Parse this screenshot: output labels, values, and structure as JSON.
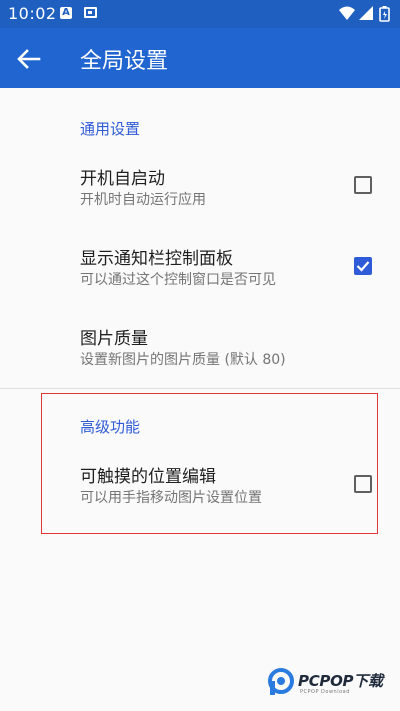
{
  "status_bar": {
    "time": "10:02",
    "a_icon": "A"
  },
  "app_bar": {
    "title": "全局设置",
    "back_icon": "arrow-left-icon"
  },
  "sections": [
    {
      "title": "通用设置",
      "items": [
        {
          "title": "开机自启动",
          "summary": "开机时自动运行应用",
          "checkbox": false
        },
        {
          "title": "显示通知栏控制面板",
          "summary": "可以通过这个控制窗口是否可见",
          "checkbox": true
        },
        {
          "title": "图片质量",
          "summary": "设置新图片的图片质量 (默认 80)"
        }
      ]
    },
    {
      "title": "高级功能",
      "items": [
        {
          "title": "可触摸的位置编辑",
          "summary": "可以用手指移动图片设置位置",
          "checkbox": false
        }
      ]
    }
  ],
  "watermark": {
    "brand": "PCPOP下载",
    "sub": "PCPOP Download"
  },
  "colors": {
    "status_bar": "#1e5fc0",
    "app_bar": "#2165d0",
    "accent": "#2f5bd8",
    "highlight_border": "#e23636"
  }
}
